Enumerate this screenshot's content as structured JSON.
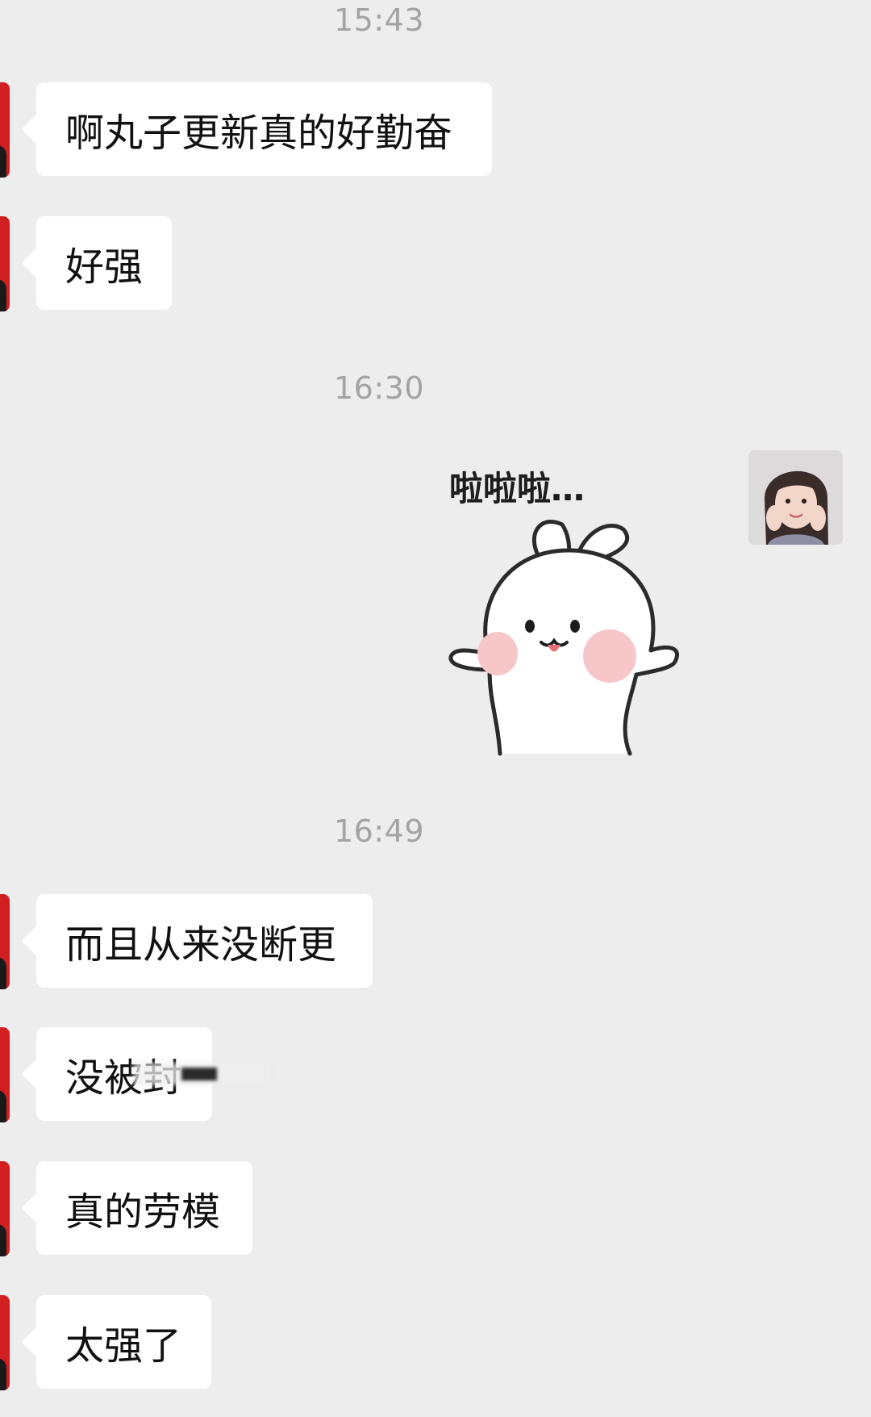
{
  "timestamps": [
    "15:43",
    "16:30",
    "16:49"
  ],
  "messages": [
    {
      "sender": "left",
      "text": "啊丸子更新真的好勤奋"
    },
    {
      "sender": "left",
      "text": "好强"
    },
    {
      "sender": "right",
      "type": "sticker",
      "sticker_caption": "啦啦啦…"
    },
    {
      "sender": "left",
      "text": "而且从来没断更"
    },
    {
      "sender": "left",
      "text": "没被封",
      "partially_obscured": true
    },
    {
      "sender": "left",
      "text": "真的劳模"
    },
    {
      "sender": "left",
      "text": "太强了"
    }
  ],
  "colors": {
    "background": "#ededed",
    "bubble": "#ffffff",
    "timestamp": "#a3a3a3",
    "left_avatar": "#d21f1f"
  },
  "icons": {
    "left_avatar": "avatar-red",
    "right_avatar": "avatar-photo",
    "sticker": "rabbit-sticker"
  }
}
